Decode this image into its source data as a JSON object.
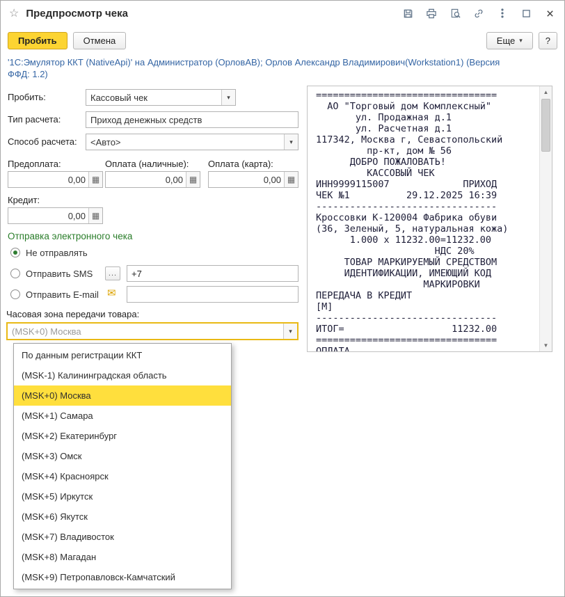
{
  "window": {
    "title": "Предпросмотр чека"
  },
  "toolbar": {
    "commit": "Пробить",
    "cancel": "Отмена",
    "more": "Еще",
    "help": "?"
  },
  "info_text": "'1С:Эмулятор ККТ (NativeApi)' на Администратор (ОрловАВ); Орлов Александр Владимирович(Workstation1) (Версия ФФД: 1.2)",
  "form": {
    "probit_label": "Пробить:",
    "probit_value": "Кассовый чек",
    "calc_type_label": "Тип расчета:",
    "calc_type_value": "Приход денежных средств",
    "calc_method_label": "Способ расчета:",
    "calc_method_value": "<Авто>",
    "prepayment_label": "Предоплата:",
    "cash_label": "Оплата (наличные):",
    "card_label": "Оплата (карта):",
    "prepayment_value": "0,00",
    "cash_value": "0,00",
    "card_value": "0,00",
    "credit_label": "Кредит:",
    "credit_value": "0,00",
    "send_section_title": "Отправка электронного чека",
    "radio_none": "Не отправлять",
    "radio_sms": "Отправить SMS",
    "radio_email": "Отправить E-mail",
    "sms_value": "+7",
    "email_value": "",
    "timezone_label": "Часовая зона передачи товара:",
    "timezone_value": "(MSK+0) Москва"
  },
  "timezone_dropdown": {
    "items": [
      {
        "label": "По данным регистрации ККТ",
        "selected": false
      },
      {
        "label": "(MSK-1) Калининградская область",
        "selected": false
      },
      {
        "label": "(MSK+0) Москва",
        "selected": true
      },
      {
        "label": "(MSK+1) Самара",
        "selected": false
      },
      {
        "label": "(MSK+2) Екатеринбург",
        "selected": false
      },
      {
        "label": "(MSK+3) Омск",
        "selected": false
      },
      {
        "label": "(MSK+4) Красноярск",
        "selected": false
      },
      {
        "label": "(MSK+5) Иркутск",
        "selected": false
      },
      {
        "label": "(MSK+6) Якутск",
        "selected": false
      },
      {
        "label": "(MSK+7) Владивосток",
        "selected": false
      },
      {
        "label": "(MSK+8) Магадан",
        "selected": false
      },
      {
        "label": "(MSK+9) Петропавловск-Камчатский",
        "selected": false
      }
    ]
  },
  "receipt": {
    "lines": [
      "================================",
      "  АО \"Торговый дом Комплексный\"",
      "       ул. Продажная д.1",
      "       ул. Расчетная д.1",
      "117342, Москва г, Севастопольский",
      "         пр-кт, дом № 56",
      "      ДОБРО ПОЖАЛОВАТЬ!",
      "         КАССОВЫЙ ЧЕК",
      "ИНН9999115007             ПРИХОД",
      "ЧЕК №1          29.12.2025 16:39",
      "--------------------------------",
      "Кроссовки К-120004 Фабрика обуви",
      "(36, Зеленый, 5, натуральная кожа)",
      "      1.000 x 11232.00=11232.00",
      "                     НДС 20%",
      "     ТОВАР МАРКИРУЕМЫЙ СРЕДСТВОМ",
      "     ИДЕНТИФИКАЦИИ, ИМЕЮЩИЙ КОД",
      "                   МАРКИРОВКИ",
      "ПЕРЕДАЧА В КРЕДИТ",
      "[M]",
      "--------------------------------",
      "ИТОГ=                   11232.00",
      "================================",
      "ОПЛАТА"
    ]
  },
  "icons": {
    "favorite": "☆",
    "calculator": "▦",
    "envelope": "✉",
    "dropdown_arrow": "▾",
    "sms_ellipsis": "...",
    "scroll_up": "▲",
    "scroll_down": "▼"
  },
  "colors": {
    "primary_button": "#fcd432",
    "selection": "#ffdf3d",
    "section_title": "#2a7d2a",
    "info_link": "#3465a4",
    "focus_border": "#e9b915"
  }
}
